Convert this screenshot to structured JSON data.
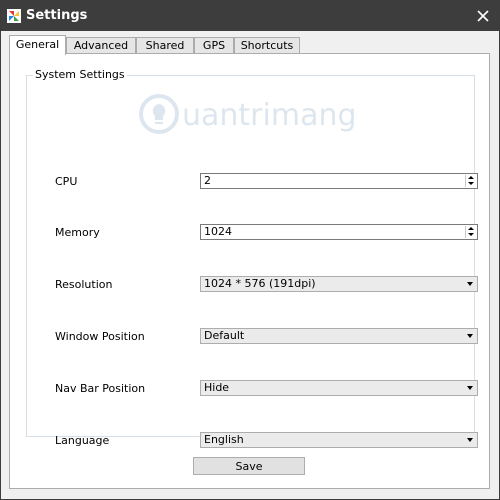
{
  "window": {
    "title": "Settings",
    "title_bar_color": "#3d3d3d",
    "app_icon": "colorful-pinwheel-icon",
    "close_icon": "close-icon"
  },
  "tabs": [
    {
      "label": "General",
      "active": true
    },
    {
      "label": "Advanced",
      "active": false
    },
    {
      "label": "Shared",
      "active": false
    },
    {
      "label": "GPS",
      "active": false
    },
    {
      "label": "Shortcuts",
      "active": false
    }
  ],
  "group": {
    "title": "System Settings"
  },
  "watermark": {
    "text": "uantrimang"
  },
  "settings": {
    "cpu": {
      "label": "CPU",
      "value": "2"
    },
    "memory": {
      "label": "Memory",
      "value": "1024"
    },
    "resolution": {
      "label": "Resolution",
      "value": "1024 * 576 (191dpi)"
    },
    "window_position": {
      "label": "Window Position",
      "value": "Default"
    },
    "nav_bar_position": {
      "label": "Nav Bar Position",
      "value": "Hide"
    },
    "language": {
      "label": "Language",
      "value": "English"
    }
  },
  "save_label": "Save"
}
